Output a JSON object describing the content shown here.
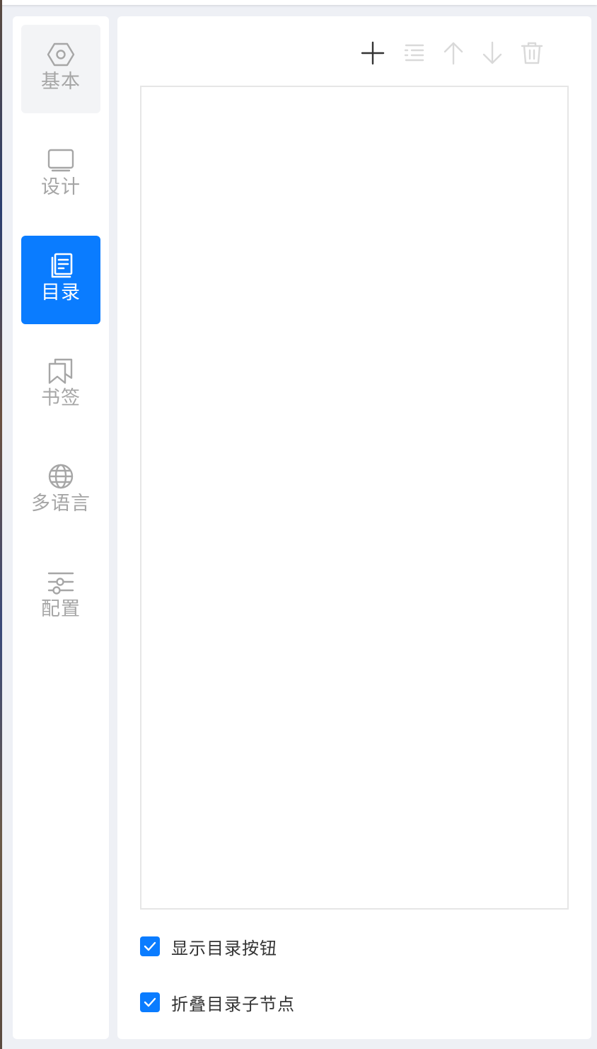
{
  "sidebar": {
    "items": [
      {
        "label": "基本",
        "icon": "hexagon-nut-icon",
        "state": "hover"
      },
      {
        "label": "设计",
        "icon": "monitor-icon",
        "state": "normal"
      },
      {
        "label": "目录",
        "icon": "catalog-icon",
        "state": "active"
      },
      {
        "label": "书签",
        "icon": "bookmark-icon",
        "state": "normal"
      },
      {
        "label": "多语言",
        "icon": "globe-icon",
        "state": "normal"
      },
      {
        "label": "配置",
        "icon": "sliders-icon",
        "state": "normal"
      }
    ]
  },
  "toolbar": {
    "buttons": [
      {
        "icon": "plus-icon",
        "enabled": true
      },
      {
        "icon": "indent-list-icon",
        "enabled": false
      },
      {
        "icon": "arrow-up-icon",
        "enabled": false
      },
      {
        "icon": "arrow-down-icon",
        "enabled": false
      },
      {
        "icon": "trash-icon",
        "enabled": false
      }
    ]
  },
  "options": [
    {
      "label": "显示目录按钮",
      "checked": true
    },
    {
      "label": "折叠目录子节点",
      "checked": true
    }
  ],
  "colors": {
    "accent": "#0a7cff",
    "muted": "#a6a6a6",
    "disabled": "#d9d9d9",
    "text": "#333333"
  }
}
